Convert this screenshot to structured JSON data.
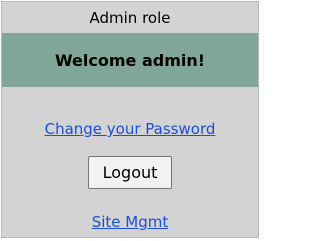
{
  "panel": {
    "role_label": "Admin role",
    "welcome": "Welcome admin!",
    "change_password_link": "Change your Password",
    "logout_button": "Logout",
    "site_mgmt_link": "Site Mgmt"
  },
  "colors": {
    "panel_background": "#d3d3d3",
    "welcome_bar": "#7fa696",
    "link": "#1a4fd6",
    "button_background": "#f2f2f2"
  }
}
